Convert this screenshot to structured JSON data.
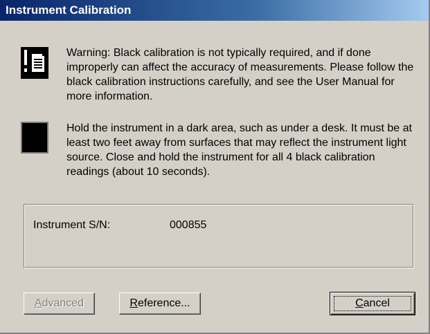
{
  "window": {
    "title": "Instrument Calibration"
  },
  "icons": {
    "warning": "document-warning-icon",
    "black_tile": "black-calibration-tile-icon"
  },
  "messages": {
    "warning_text": "Warning: Black calibration is not typically required, and if done improperly can affect the accuracy of measurements.  Please follow the black calibration instructions carefully, and see the User Manual for more information.",
    "instruction_text": "Hold the instrument in a dark area, such as under a desk.  It must be at least two feet away from surfaces that may reflect the instrument light source.  Close and hold the instrument for all 4 black calibration readings (about 10 seconds)."
  },
  "instrument": {
    "sn_label": "Instrument S/N:",
    "sn_value": "000855"
  },
  "buttons": {
    "advanced": {
      "label": "Advanced",
      "enabled": false
    },
    "reference": {
      "label": "Reference...",
      "enabled": true
    },
    "cancel": {
      "label": "Cancel",
      "enabled": true,
      "focused": true
    }
  },
  "colors": {
    "dialog_bg": "#d4d0c8",
    "title_start": "#0a246a",
    "title_end": "#a6caf0",
    "disabled_text": "#808080"
  }
}
